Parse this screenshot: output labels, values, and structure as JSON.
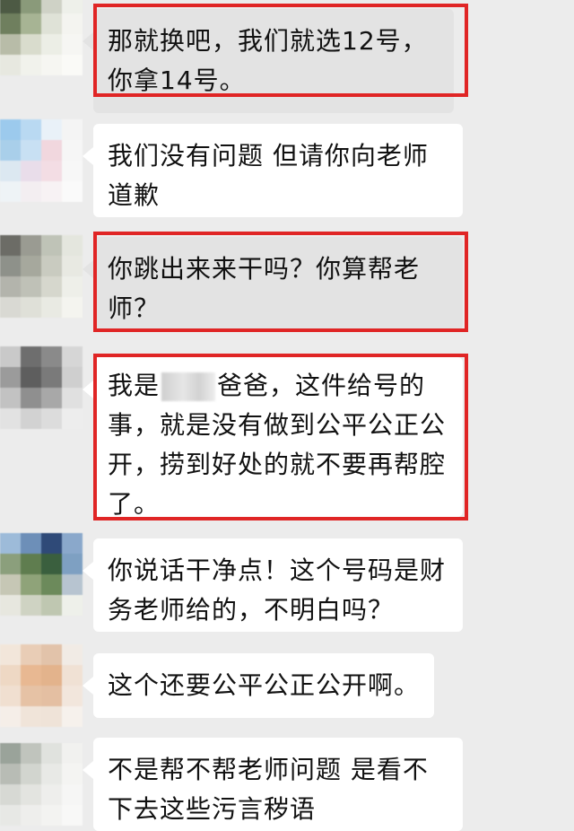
{
  "messages": [
    {
      "text": "那就换吧，我们就选12号，你拿14号。",
      "bubble_style": "gray",
      "highlighted": true,
      "avatar_colors": [
        "#4d5a44",
        "#8a9a7a",
        "#cfd2c6",
        "#eef0ea",
        "#6f7f5e",
        "#a7b494",
        "#dfe2d7",
        "#f4f4f0",
        "#b8bca8",
        "#d9dccd",
        "#eceee6",
        "#f6f6f3",
        "#e7e8e0",
        "#f1f2ec",
        "#f6f6f2",
        "#fafaf7"
      ]
    },
    {
      "text": "我们没有问题 但请你向老师道歉",
      "bubble_style": "white",
      "highlighted": false,
      "avatar_colors": [
        "#9ccaed",
        "#b9d9f2",
        "#e9f1f8",
        "#f4f4f4",
        "#a9cfea",
        "#c8e0f3",
        "#f1d7de",
        "#f6f6f6",
        "#dce8f1",
        "#e9ddea",
        "#f3dde4",
        "#f7f7f7",
        "#eef3f6",
        "#f3eef1",
        "#f7f2f4",
        "#fafafa"
      ]
    },
    {
      "text": "你跳出来来干吗？你算帮老师？",
      "bubble_style": "gray",
      "highlighted": true,
      "avatar_colors": [
        "#6c6c66",
        "#9a9b92",
        "#bfc3b7",
        "#e4e6de",
        "#8e918a",
        "#a6a89d",
        "#c9cbc0",
        "#e8e9e2",
        "#b3b4ac",
        "#bfc1b7",
        "#d6d7cd",
        "#eeefe9",
        "#d9d9d3",
        "#dfe0d8",
        "#e9eae3",
        "#f4f4ef"
      ]
    },
    {
      "text_before": "我是",
      "text_after": "爸爸，这件给号的事，就是没有做到公平公正公开，捞到好处的就不要再帮腔了。",
      "bubble_style": "white",
      "highlighted": true,
      "has_censor": true,
      "avatar_colors": [
        "#c9c9c9",
        "#6e6e6e",
        "#8a8a8a",
        "#d6d6d6",
        "#9b9b9b",
        "#5e5e5e",
        "#7a7a7a",
        "#cfcfcf",
        "#c2c2c2",
        "#8f8f8f",
        "#a8a8a8",
        "#e0e0e0",
        "#e2e2e2",
        "#d2d2d2",
        "#dcdcdc",
        "#ededed"
      ]
    },
    {
      "text": "你说话干净点！这个号码是财务老师给的，不明白吗？",
      "bubble_style": "white",
      "highlighted": false,
      "avatar_colors": [
        "#9dbbd9",
        "#6d8fb8",
        "#2f4a78",
        "#8aa8cb",
        "#8b9f7c",
        "#5f7d4f",
        "#3a5f3e",
        "#7ea0c2",
        "#c6c7b5",
        "#8fa379",
        "#6c8a5b",
        "#b7c4d0",
        "#e7e7df",
        "#cfd3c3",
        "#bfc7b1",
        "#eef0ea"
      ]
    },
    {
      "text": "这个还要公平公正公开啊。",
      "bubble_style": "white",
      "highlighted": false,
      "avatar_colors": [
        "#f2e6da",
        "#e9cdb6",
        "#e2c3aa",
        "#f1ebe5",
        "#eed8c4",
        "#e8b892",
        "#e3b38c",
        "#f0e1d4",
        "#f0dfd0",
        "#e6c2a5",
        "#e4bfa2",
        "#f2e6dc",
        "#f5eee8",
        "#f0e4d9",
        "#efe3d8",
        "#f6f1ec"
      ]
    },
    {
      "text": "不是帮不帮老师问题 是看不下去这些污言秽语",
      "bubble_style": "white",
      "highlighted": false,
      "avatar_colors": [
        "#9aa39a",
        "#c0c4bd",
        "#e0e2de",
        "#f1f1ef",
        "#b8bcb5",
        "#d2d5cf",
        "#e8e9e6",
        "#f4f4f2",
        "#d7d9d4",
        "#e3e4e0",
        "#eeeeec",
        "#f6f6f5",
        "#e7e8e5",
        "#eeeeec",
        "#f3f3f1",
        "#f8f8f7"
      ]
    }
  ],
  "highlight_color": "#e02525"
}
